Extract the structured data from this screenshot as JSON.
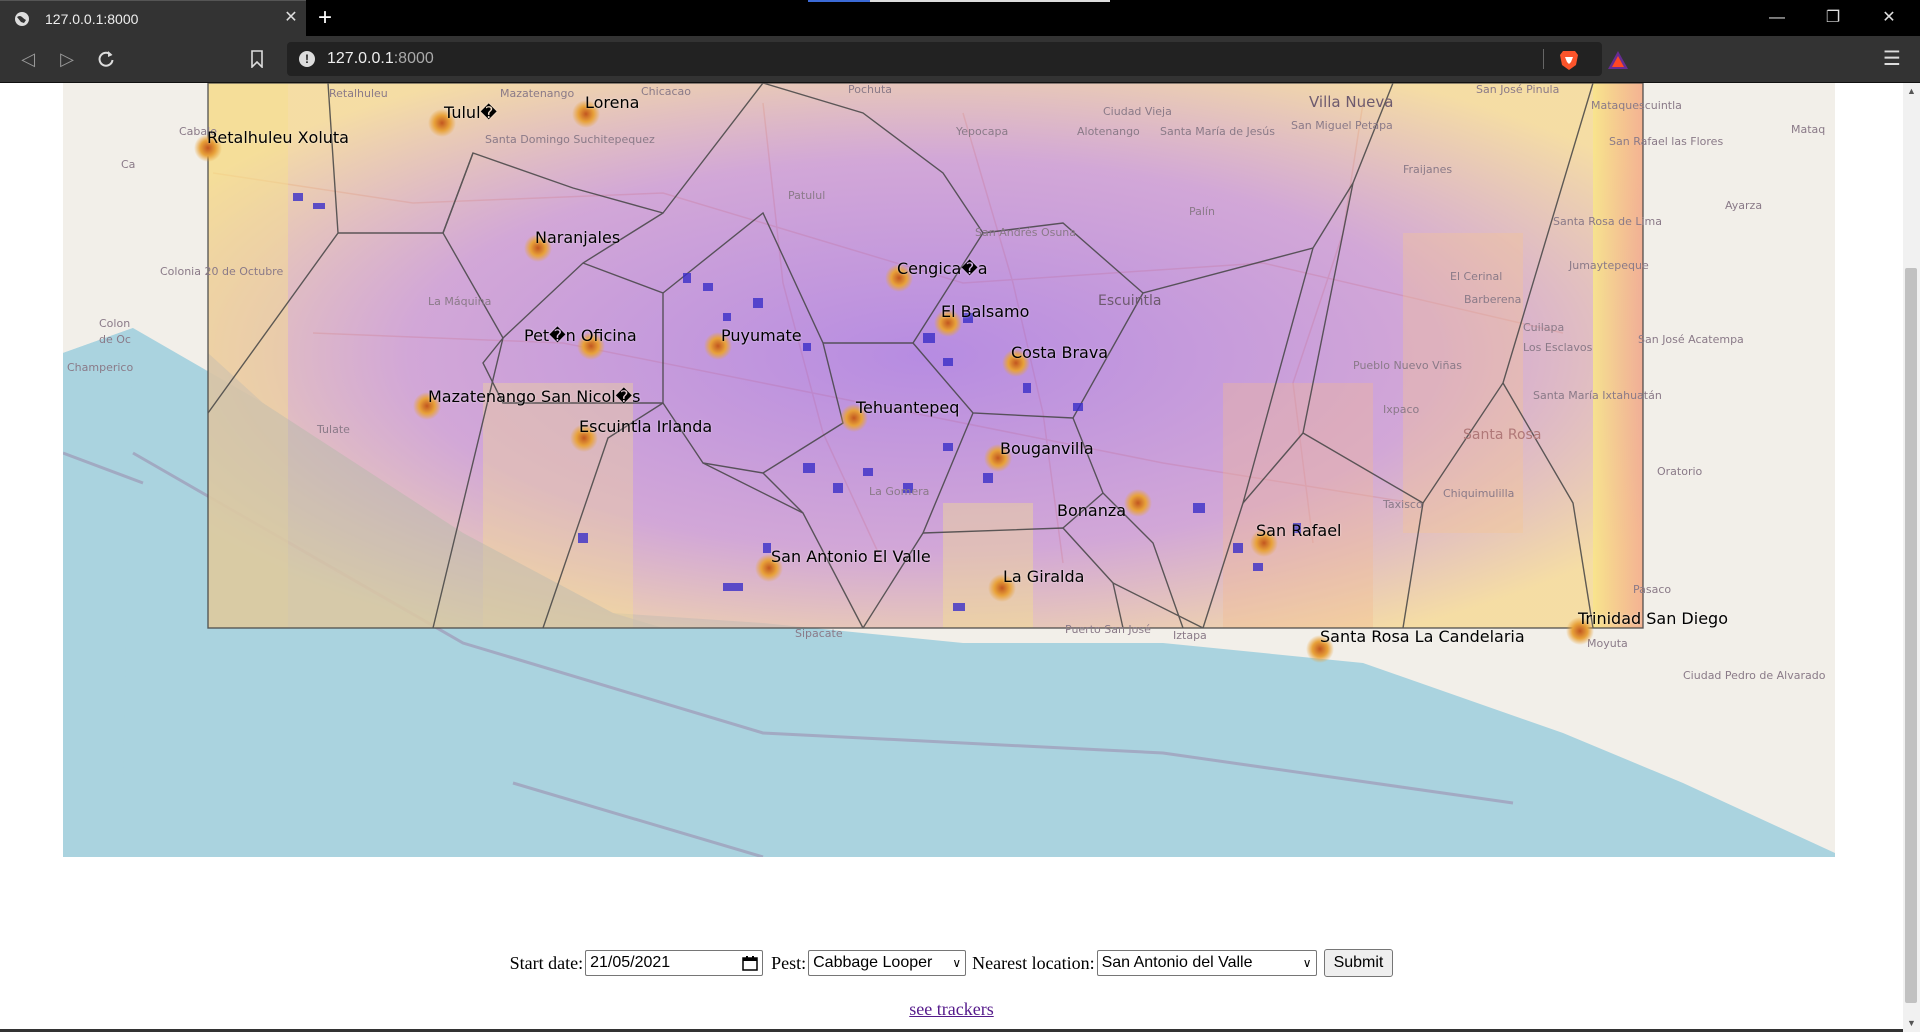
{
  "browser": {
    "tab_title": "127.0.0.1:8000",
    "url_host": "127.0.0.1",
    "url_port": ":8000",
    "new_tab_label": "+",
    "close_tab_label": "✕",
    "window_minimize": "—",
    "window_restore": "❐",
    "window_close": "✕",
    "menu_label": "☰"
  },
  "map": {
    "locations": [
      {
        "name": "Retalhuleu Xoluta"
      },
      {
        "name": "Tulul�"
      },
      {
        "name": "Lorena"
      },
      {
        "name": "Naranjales"
      },
      {
        "name": "Cengica�a"
      },
      {
        "name": "El Balsamo"
      },
      {
        "name": "Costa Brava"
      },
      {
        "name": "Pet�n Oficina"
      },
      {
        "name": "Puyumate"
      },
      {
        "name": "Mazatenango San Nicol�s"
      },
      {
        "name": "Escuintla Irlanda"
      },
      {
        "name": "Tehuantepeq"
      },
      {
        "name": "Bouganvilla"
      },
      {
        "name": "Bonanza"
      },
      {
        "name": "San Rafael"
      },
      {
        "name": "San Antonio El Valle"
      },
      {
        "name": "La Giralda"
      },
      {
        "name": "Santa Rosa La Candelaria"
      },
      {
        "name": "Trinidad San Diego"
      }
    ],
    "background_places": [
      "Retalhuleu",
      "Mazatenango",
      "Chicacao",
      "Pochuta",
      "Yepocapa",
      "Ciudad Vieja",
      "Alotenango",
      "Santa María de Jesús",
      "Villa Nueva",
      "San Miguel Petapa",
      "San José Pinula",
      "Mataquescuintla",
      "San Rafael las Flores",
      "Santa Domingo Suchitepequez",
      "Patulul",
      "San Andrés Osuna",
      "Escuintla",
      "Palín",
      "Fraijanes",
      "Santa Rosa de Lima",
      "Jumaytepeque",
      "El Cerinal",
      "Barberena",
      "Cuilapa",
      "Los Esclavos",
      "Colonia 20 de Octubre",
      "Champerico",
      "La Máquina",
      "Tulate",
      "La Gomera",
      "Pueblo Nuevo Viñas",
      "Ixpaco",
      "Santa María Ixtahuatán",
      "Santa Rosa",
      "Oratorio",
      "Taxisco",
      "Chiquimulilla",
      "Pasaco",
      "Moyuta",
      "Ciudad Pedro de Alvarado",
      "Sipacate",
      "Puerto San José",
      "Iztapa",
      "San José Acatempa",
      "Cabale",
      "Ca",
      "Colon",
      "de Oc",
      "Ayarza",
      "Mataq"
    ],
    "colors": {
      "water": "#aad3df",
      "land": "#f2efe9",
      "overlay_purple": "#b57ad8",
      "overlay_yellow": "#f8e58a",
      "cell_border": "#555555",
      "marker": "#e8a23a"
    }
  },
  "form": {
    "start_date_label": "Start date:",
    "start_date_value": "21/05/2021",
    "pest_label": "Pest:",
    "pest_value": "Cabbage Looper",
    "location_label": "Nearest location:",
    "location_value": "San Antonio del Valle",
    "submit_label": "Submit"
  },
  "links": {
    "see_trackers": "see trackers"
  }
}
